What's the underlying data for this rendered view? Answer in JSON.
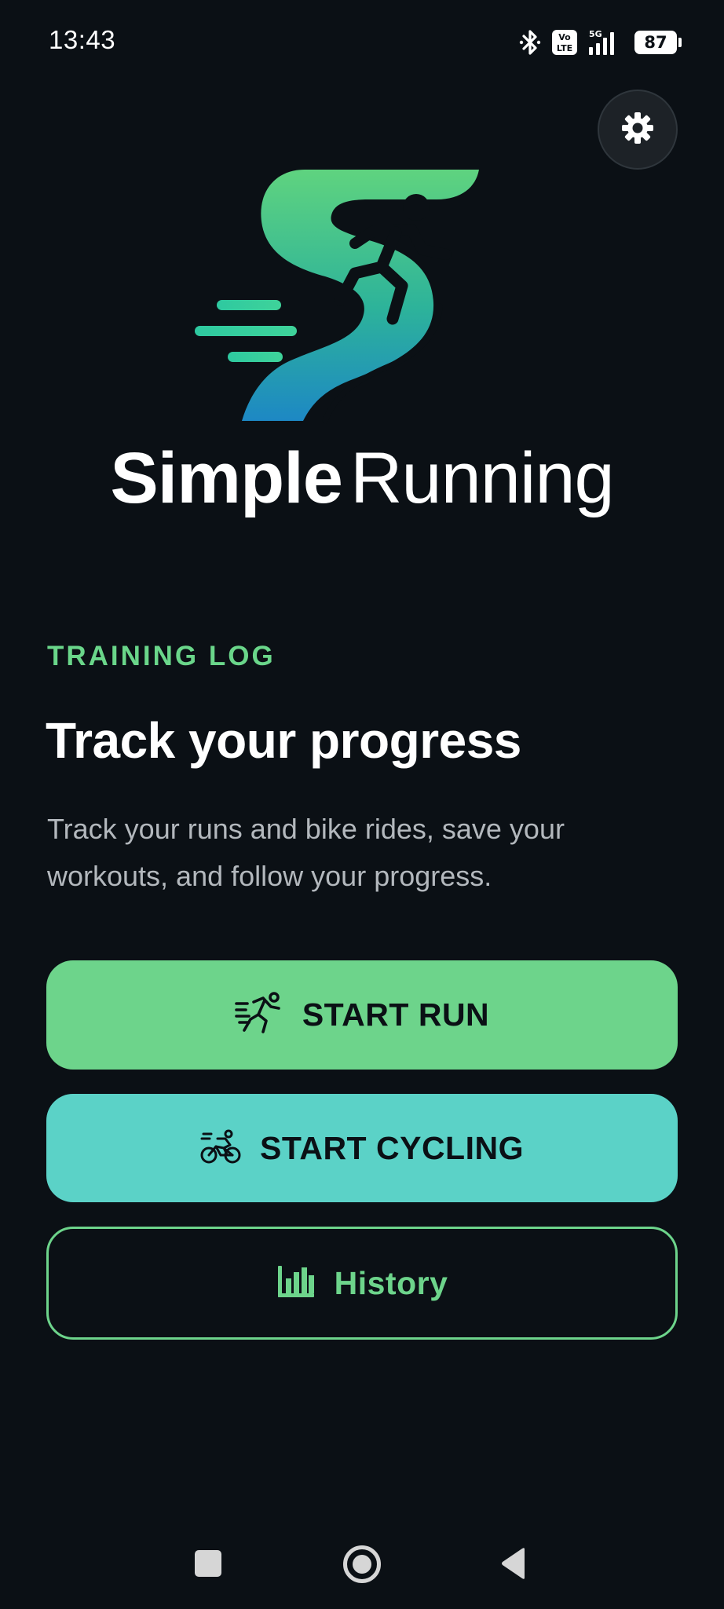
{
  "status_bar": {
    "time": "13:43",
    "network_label": "5G",
    "volte_top": "Vo",
    "volte_bottom": "LTE",
    "battery": "87"
  },
  "settings": {
    "icon": "gear-icon"
  },
  "brand": {
    "name_bold": "Simple",
    "name_light": "Running",
    "colors": {
      "green": "#5fd37f",
      "teal": "#27a99a",
      "blue": "#1d8fbf"
    }
  },
  "intro": {
    "eyebrow": "TRAINING LOG",
    "headline": "Track your progress",
    "description": "Track your runs and bike rides, save your workouts, and follow your progress."
  },
  "actions": {
    "start_run": "START RUN",
    "start_cycling": "START CYCLING",
    "history": "History"
  },
  "colors": {
    "background": "#0b1015",
    "run_button": "#6dd48b",
    "cycle_button": "#5bd2c7",
    "accent": "#6ad68a"
  }
}
